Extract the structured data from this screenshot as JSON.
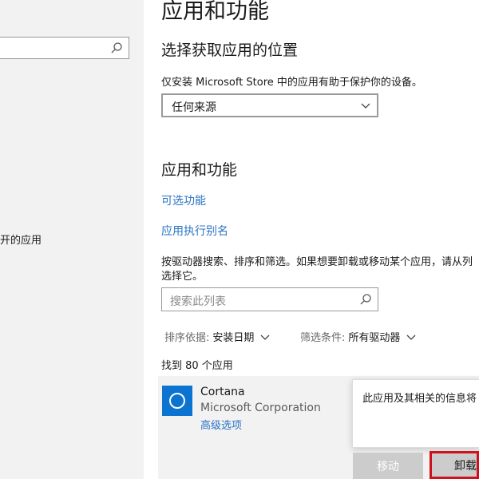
{
  "sidebar": {
    "search": {
      "placeholder": ""
    },
    "item_label": "开的应用"
  },
  "main": {
    "page_title": "应用和功能",
    "location_section": {
      "title": "选择获取应用的位置",
      "description": "仅安装 Microsoft Store 中的应用有助于保护你的设备。",
      "source_dropdown": {
        "selected": "任何来源"
      }
    },
    "apps_section": {
      "title": "应用和功能",
      "link_optional_features": "可选功能",
      "link_app_aliases": "应用执行别名",
      "instructions_line1": "按驱动器搜索、排序和筛选。如果想要卸载或移动某个应用，请从列",
      "instructions_line2": "选择它。",
      "search_placeholder": "搜索此列表",
      "sort": {
        "label": "排序依据:",
        "value": "安装日期"
      },
      "filter": {
        "label": "筛选条件:",
        "value": "所有驱动器"
      },
      "count_text": "找到 80 个应用"
    },
    "app_item": {
      "name": "Cortana",
      "publisher": "Microsoft Corporation",
      "advanced_link": "高级选项",
      "icon_color": "#0a74d0"
    },
    "uninstall_popup": {
      "message": "此应用及其相关的信息将"
    },
    "buttons": {
      "move": "移动",
      "uninstall": "卸载"
    }
  },
  "colors": {
    "accent": "#2a74c4",
    "highlight_border": "#d0101a",
    "sidebar_bg": "#f2f2f2"
  }
}
